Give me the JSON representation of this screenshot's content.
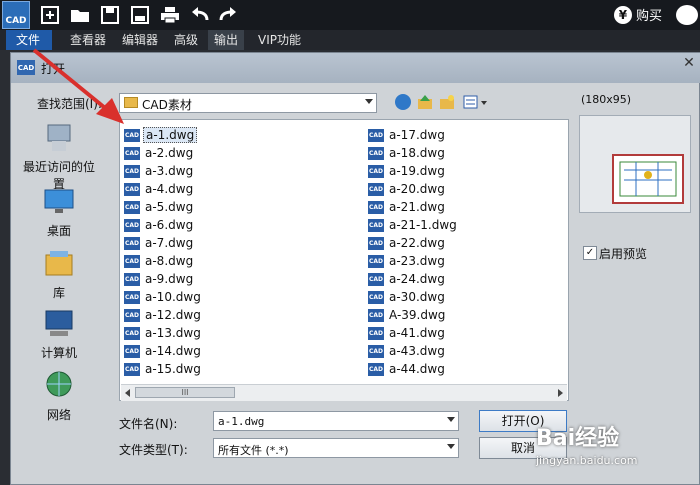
{
  "app": {
    "logo_text": "CAD",
    "buy_label": "购买",
    "buy_symbol": "¥"
  },
  "menu": [
    "文件",
    "查看器",
    "编辑器",
    "高级",
    "输出",
    "VIP功能"
  ],
  "dialog": {
    "title": "打开",
    "title_icon": "CAD",
    "lookin_label": "查找范围(I):",
    "lookin_value": "CAD素材",
    "places": [
      "最近访问的位置",
      "桌面",
      "库",
      "计算机",
      "网络"
    ],
    "files_col1": [
      "a-1.dwg",
      "a-2.dwg",
      "a-3.dwg",
      "a-4.dwg",
      "a-5.dwg",
      "a-6.dwg",
      "a-7.dwg",
      "a-8.dwg",
      "a-9.dwg",
      "a-10.dwg",
      "a-12.dwg",
      "a-13.dwg",
      "a-14.dwg",
      "a-15.dwg"
    ],
    "files_col2": [
      "a-17.dwg",
      "a-18.dwg",
      "a-19.dwg",
      "a-20.dwg",
      "a-21.dwg",
      "a-21-1.dwg",
      "a-22.dwg",
      "a-23.dwg",
      "a-24.dwg",
      "a-30.dwg",
      "A-39.dwg",
      "a-41.dwg",
      "a-43.dwg",
      "a-44.dwg"
    ],
    "file_icon_text": "CAD",
    "filename_label": "文件名(N):",
    "filename_value": "a-1.dwg",
    "filetype_label": "文件类型(T):",
    "filetype_value": "所有文件 (*.*)",
    "open_button": "打开(O)",
    "cancel_button": "取消",
    "preview_size": "(180x95)",
    "preview_checkbox_label": "启用预览",
    "scroll_thumb": "III"
  },
  "watermark": {
    "brand": "Bai经验",
    "url": "jingyan.baidu.com"
  },
  "colors": {
    "accent": "#1f5aa8",
    "arrow": "#d9302c",
    "cad_icon": "#2a5da6"
  }
}
